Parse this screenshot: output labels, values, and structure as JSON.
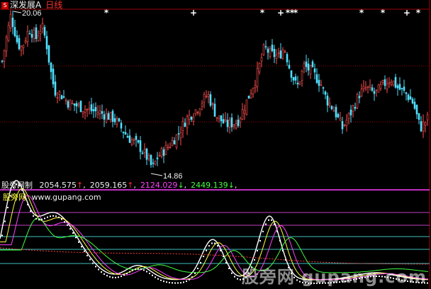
{
  "header": {
    "icon_label": "S",
    "stock_name": "深发展A",
    "period": "日线"
  },
  "price_labels": {
    "high": "20.06",
    "low": "14.86"
  },
  "indicator_bar": {
    "name": "股旁网制",
    "values": [
      {
        "text": "2054.575",
        "arrow": "↑",
        "color": "#f0f0f0",
        "arrow_color": "#ff3030",
        "sep": ","
      },
      {
        "text": "2059.165",
        "arrow": "↑",
        "color": "#f0f0f0",
        "arrow_color": "#ff3030",
        "sep": ","
      },
      {
        "text": "2124.029",
        "arrow": "↓",
        "color": "#ff40ff",
        "arrow_color": "#40ff40",
        "sep": ","
      },
      {
        "text": "2449.139",
        "arrow": "↓",
        "color": "#40ff40",
        "arrow_color": "#40ff40",
        "sep": ","
      }
    ]
  },
  "panel2": {
    "title": "股旁网",
    "url": "www.gupang.com"
  },
  "watermark": "股旁网 gupang.com",
  "markers": {
    "star_glyph": "*",
    "plus_glyph": "+"
  },
  "colors": {
    "up": "#ff5050",
    "down": "#50e0ff",
    "panel_border": "#ff40ff",
    "grid_red": "#a00000",
    "grid_pink": "#c040c0",
    "grid_cyan": "#40c0c0",
    "white_line": "#ffffff",
    "yellow_line": "#ffff40",
    "magenta_line": "#ff40ff",
    "green_line": "#40ff40",
    "red_dotted": "#ff4040"
  },
  "chart_data": {
    "type": "candlestick",
    "title": "",
    "y_high": 20.06,
    "y_low": 14.86,
    "subplots": 2
  }
}
